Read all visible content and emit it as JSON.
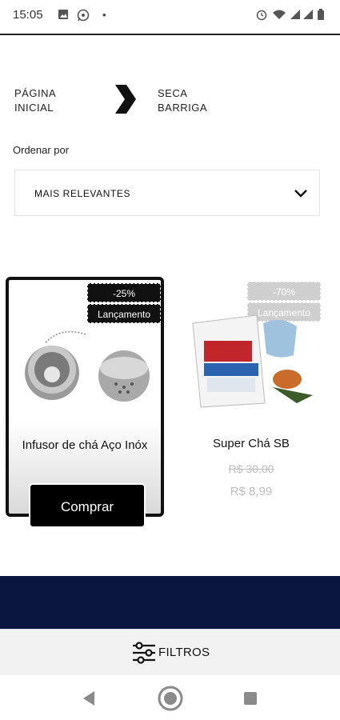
{
  "status_bar": {
    "time": "15:05",
    "icons_left": [
      "image-icon",
      "whatsapp-icon",
      "dot-icon"
    ],
    "icons_right": [
      "alarm-icon",
      "wifi-icon",
      "signal-icon",
      "signal-icon",
      "battery-icon"
    ]
  },
  "breadcrumb": {
    "home": "PÁGINA INICIAL",
    "current": "SECA BARRIGA"
  },
  "sort": {
    "label": "Ordenar por",
    "selected": "MAIS RELEVANTES"
  },
  "products": [
    {
      "name": "Infusor de chá Aço Inóx",
      "discount": "-25%",
      "tag": "Lançamento",
      "buy_label": "Comprar"
    },
    {
      "name": "Super Chá SB",
      "discount": "-70%",
      "tag": "Lançamento",
      "price_old": "R$ 30,00",
      "price_new": "R$ 8,99"
    }
  ],
  "filter": {
    "label": "FILTROS"
  },
  "colors": {
    "footer_band": "#0b1640",
    "badge": "#111111",
    "price": "#bdbdbd"
  }
}
